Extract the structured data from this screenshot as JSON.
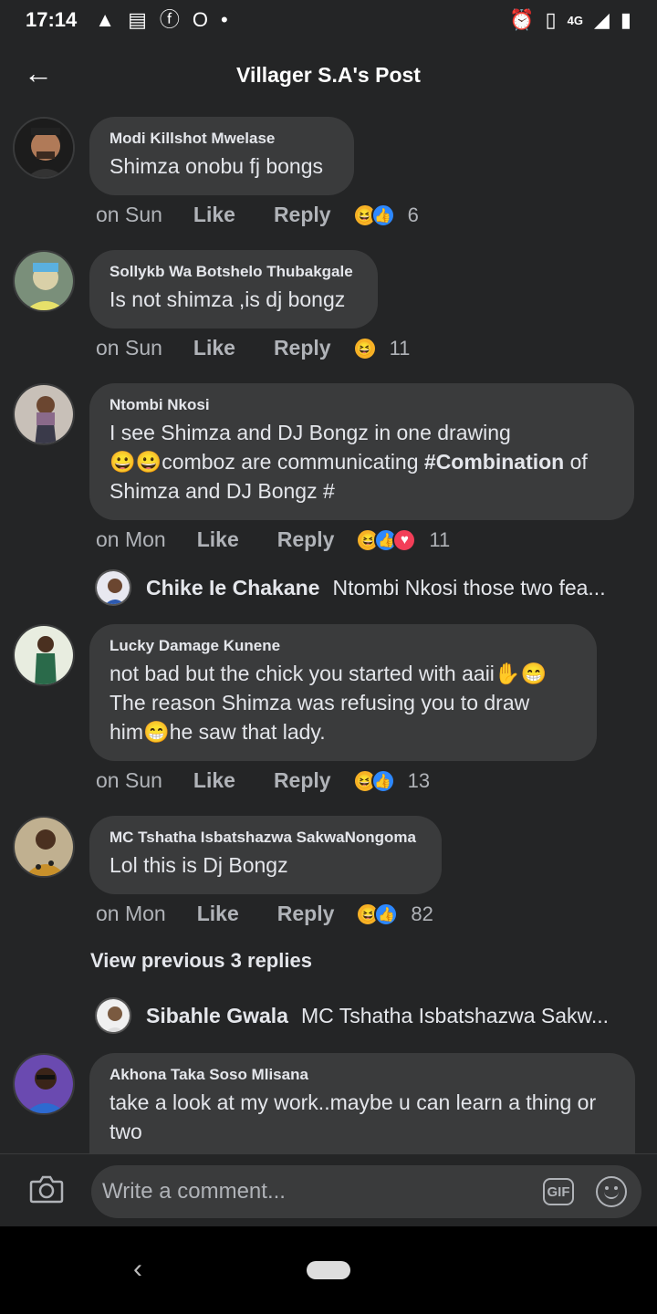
{
  "status": {
    "time": "17:14",
    "network": "4G"
  },
  "header": {
    "title": "Villager S.A's Post"
  },
  "comments": [
    {
      "name": "Modi Killshot Mwelase",
      "text": "Shimza onobu fj bongs",
      "time": "on Sun",
      "like": "Like",
      "reply": "Reply",
      "count": "6"
    },
    {
      "name": "Sollykb Wa Botshelo Thubakgale",
      "text": "Is not shimza ,is dj bongz",
      "time": "on Sun",
      "like": "Like",
      "reply": "Reply",
      "count": "11"
    },
    {
      "name": "Ntombi Nkosi",
      "text1": "I see Shimza and DJ Bongz in one drawing",
      "text2": "comboz are communicating ",
      "hashtag": "#Combination",
      "text3": " of",
      "text4": "Shimza and DJ Bongz #",
      "time": "on Mon",
      "like": "Like",
      "reply": "Reply",
      "count": "11"
    },
    {
      "name": "Lucky Damage Kunene",
      "text1": "not bad but the chick you started with aaii",
      "text2": "The reason Shimza was refusing you to draw",
      "text3a": "him",
      "text3b": "he saw that lady.",
      "time": "on Sun",
      "like": "Like",
      "reply": "Reply",
      "count": "13"
    },
    {
      "name": "MC Tshatha Isbatshazwa SakwaNongoma",
      "text": "Lol this is Dj Bongz",
      "time": "on Mon",
      "like": "Like",
      "reply": "Reply",
      "count": "82"
    },
    {
      "name": "Akhona Taka Soso Mlisana",
      "text": "take a look at my work..maybe u can learn a thing or two"
    }
  ],
  "replies": [
    {
      "name": "Chike Ie Chakane",
      "text": "Ntombi Nkosi those two fea..."
    },
    {
      "name": "Sibahle Gwala",
      "text": "MC Tshatha Isbatshazwa Sakw..."
    }
  ],
  "view_previous": "View previous 3 replies",
  "composer": {
    "placeholder": "Write a comment...",
    "gif": "GIF"
  },
  "icons": [
    "back-arrow-icon",
    "camera-icon",
    "gif-icon",
    "emoji-icon",
    "nav-back-icon",
    "home-pill-icon"
  ]
}
